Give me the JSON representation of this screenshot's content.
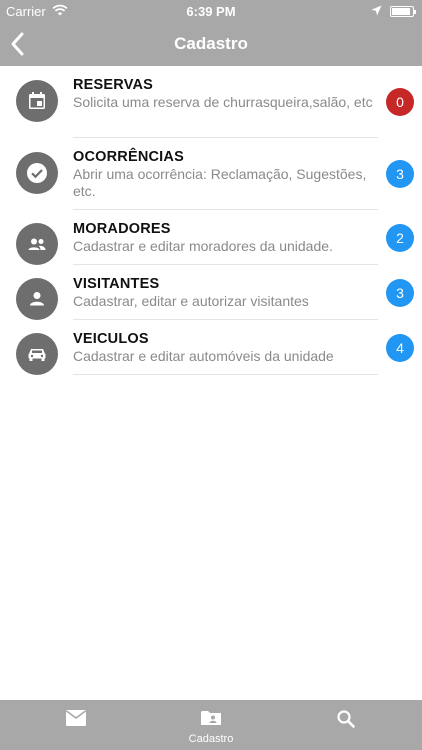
{
  "status_bar": {
    "carrier": "Carrier",
    "time": "6:39 PM",
    "battery_level": 0.9
  },
  "nav": {
    "title": "Cadastro"
  },
  "items": [
    {
      "title": "RESERVAS",
      "subtitle": "Solicita uma reserva de churrasqueira,salão, etc",
      "badge": "0",
      "badge_color": "#c62828",
      "icon": "calendar-icon"
    },
    {
      "title": "OCORRÊNCIAS",
      "subtitle": "Abrir uma ocorrência: Reclamação, Sugestões, etc.",
      "badge": "3",
      "badge_color": "#2196f3",
      "icon": "check-circle-icon"
    },
    {
      "title": "MORADORES",
      "subtitle": "Cadastrar e editar moradores da unidade.",
      "badge": "2",
      "badge_color": "#2196f3",
      "icon": "people-icon"
    },
    {
      "title": "VISITANTES",
      "subtitle": "Cadastrar, editar e autorizar visitantes",
      "badge": "3",
      "badge_color": "#2196f3",
      "icon": "person-icon"
    },
    {
      "title": "VEICULOS",
      "subtitle": "Cadastrar e editar automóveis da unidade",
      "badge": "4",
      "badge_color": "#2196f3",
      "icon": "car-icon"
    }
  ],
  "tab_bar": {
    "tabs": [
      {
        "label": "",
        "icon": "mail-icon"
      },
      {
        "label": "Cadastro",
        "icon": "folder-person-icon"
      },
      {
        "label": "",
        "icon": "search-icon"
      }
    ]
  },
  "colors": {
    "bar_background": "#a8a8a8",
    "icon_circle": "#6e6e6e",
    "badge_red": "#c62828",
    "badge_blue": "#2196f3"
  }
}
